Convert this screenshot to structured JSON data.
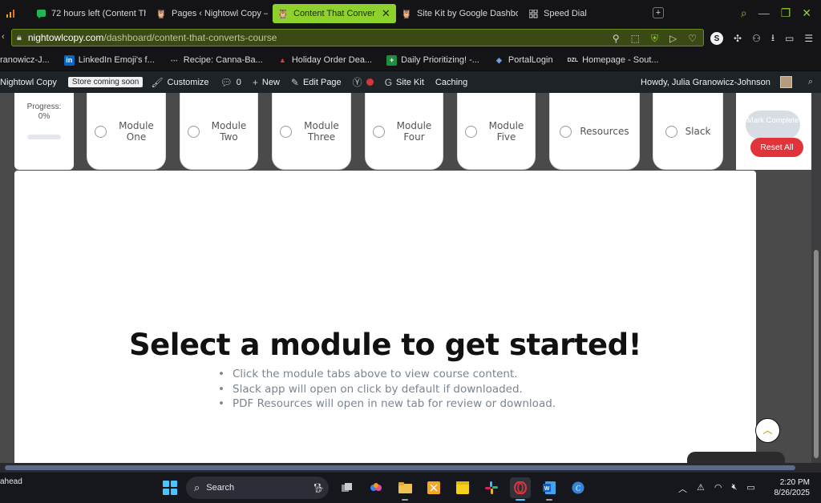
{
  "browser": {
    "tabs": [
      {
        "icon": "chart-bars-icon",
        "title": ""
      },
      {
        "icon": "chat-bubble-icon",
        "title": "72 hours left (Content Tha"
      },
      {
        "icon": "owl-icon",
        "title": "Pages ‹ Nightowl Copy —"
      },
      {
        "icon": "owl-icon",
        "title": "Content That Conver",
        "active": true
      },
      {
        "icon": "owl-icon",
        "title": "Site Kit by Google Dashbo"
      },
      {
        "icon": "grid-icon",
        "title": "Speed Dial"
      }
    ],
    "new_tab": "+",
    "url_domain": "nightowlcopy.com",
    "url_path": "/dashboard/content-that-converts-course",
    "accent": "#8fd12c"
  },
  "bookmarks": [
    {
      "icon": "",
      "label": "ranowicz-J..."
    },
    {
      "icon": "in",
      "label": "LinkedIn Emoji's f..."
    },
    {
      "icon": "⋯",
      "label": "Recipe: Canna-Ba..."
    },
    {
      "icon": "▲",
      "label": "Holiday Order Dea..."
    },
    {
      "icon": "+",
      "label": "Daily Prioritizing! -..."
    },
    {
      "icon": "◈",
      "label": "PortalLogin"
    },
    {
      "icon": "DZL",
      "label": "Homepage - Sout..."
    }
  ],
  "wp_admin": {
    "site": "Nightowl Copy",
    "store_badge": "Store coming soon",
    "customize": "Customize",
    "comments": "0",
    "new": "New",
    "edit_page": "Edit Page",
    "site_kit": "Site Kit",
    "caching": "Caching",
    "howdy": "Howdy, Julia Granowicz-Johnson"
  },
  "course": {
    "progress_label": "Progress:",
    "progress_value": "0%",
    "progress_fraction": 0,
    "modules": [
      {
        "label": "Module One"
      },
      {
        "label": "Module Two"
      },
      {
        "label": "Module Three"
      },
      {
        "label": "Module Four"
      },
      {
        "label": "Module Five"
      },
      {
        "label": "Resources"
      },
      {
        "label": "Slack"
      }
    ],
    "mark_complete": "Mark Complete",
    "reset_all": "Reset All",
    "headline": "Select a module to get started!",
    "instructions": [
      "Click the module tabs above to view course content.",
      "Slack app will open on click by default if downloaded.",
      "PDF Resources will open in new tab for review or download."
    ]
  },
  "taskbar": {
    "left_text": "ahead",
    "search_placeholder": "Search",
    "time": "2:20 PM",
    "date": "8/26/2025"
  }
}
